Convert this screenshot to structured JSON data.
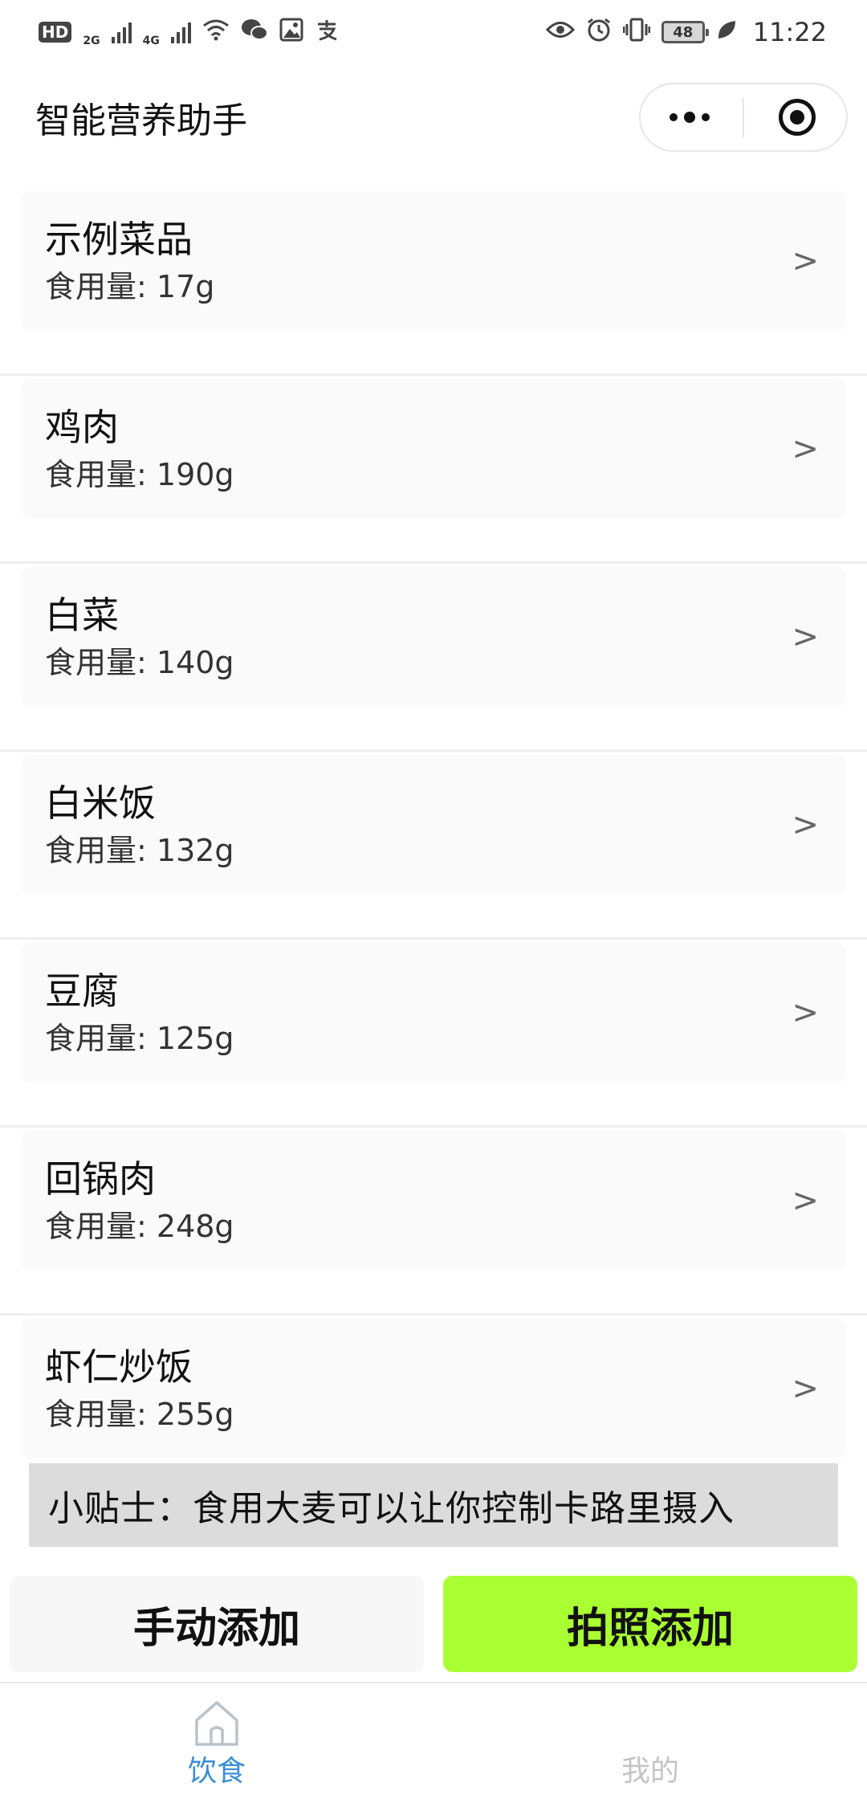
{
  "status_bar": {
    "hd": "HD",
    "net1": "2G",
    "net2": "4G",
    "battery": "48",
    "time": "11:22"
  },
  "navbar": {
    "title": "智能营养助手"
  },
  "food_list": {
    "amount_prefix": "食用量: ",
    "items": [
      {
        "name": "示例菜品",
        "amount": "17g"
      },
      {
        "name": "鸡肉",
        "amount": "190g"
      },
      {
        "name": "白菜",
        "amount": "140g"
      },
      {
        "name": "白米饭",
        "amount": "132g"
      },
      {
        "name": "豆腐",
        "amount": "125g"
      },
      {
        "name": "回锅肉",
        "amount": "248g"
      },
      {
        "name": "虾仁炒饭",
        "amount": "255g"
      }
    ],
    "chevron": ">"
  },
  "tip": {
    "text": "小贴士：食用大麦可以让你控制卡路里摄入"
  },
  "actions": {
    "manual_label": "手动添加",
    "photo_label": "拍照添加"
  },
  "tabbar": {
    "tabs": [
      {
        "label": "饮食",
        "icon": "home-icon",
        "active": true
      },
      {
        "label": "我的",
        "icon": "profile-icon",
        "active": false
      }
    ]
  },
  "colors": {
    "accent_green": "#aaff33",
    "tab_active": "#3a8ed6",
    "tip_bg": "#dcdcdc"
  }
}
